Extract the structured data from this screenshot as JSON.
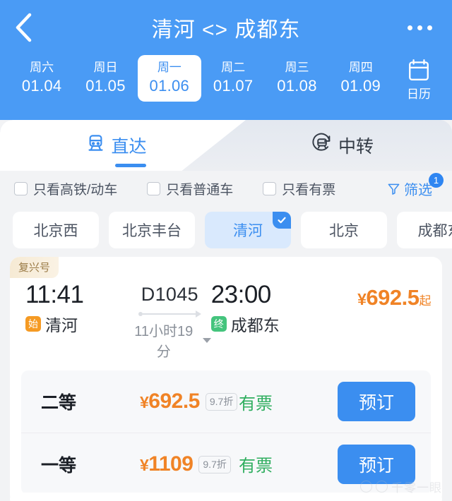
{
  "header": {
    "back_icon": "chevron-left-icon",
    "title": "清河 <> 成都东",
    "more_icon": "more-horizontal-icon",
    "calendar": {
      "icon": "calendar-icon",
      "label": "日历"
    },
    "dates": [
      {
        "weekday": "周六",
        "date": "01.04",
        "active": false
      },
      {
        "weekday": "周日",
        "date": "01.05",
        "active": false
      },
      {
        "weekday": "周一",
        "date": "01.06",
        "active": true
      },
      {
        "weekday": "周二",
        "date": "01.07",
        "active": false
      },
      {
        "weekday": "周三",
        "date": "01.08",
        "active": false
      },
      {
        "weekday": "周四",
        "date": "01.09",
        "active": false
      }
    ]
  },
  "tabs": [
    {
      "label": "直达",
      "icon": "train-front-icon",
      "active": true
    },
    {
      "label": "中转",
      "icon": "train-transfer-icon",
      "active": false
    }
  ],
  "filters": {
    "checkboxes": [
      {
        "label": "只看高铁/动车",
        "checked": false
      },
      {
        "label": "只看普通车",
        "checked": false
      },
      {
        "label": "只看有票",
        "checked": false
      }
    ],
    "filter_button": {
      "label": "筛选",
      "icon": "funnel-icon",
      "badge": "1"
    }
  },
  "stations": [
    {
      "name": "北京西",
      "selected": false
    },
    {
      "name": "北京丰台",
      "selected": false
    },
    {
      "name": "清河",
      "selected": true
    },
    {
      "name": "北京",
      "selected": false
    },
    {
      "name": "成都东",
      "selected": false
    }
  ],
  "train": {
    "brand_tag": "复兴号",
    "depart_time": "11:41",
    "depart_badge": "始",
    "depart_station": "清河",
    "train_no": "D1045",
    "duration": "11小时19分",
    "arrive_time": "23:00",
    "arrive_badge": "终",
    "arrive_station": "成都东",
    "price_yen": "¥",
    "price_from": "692.5",
    "price_suffix": "起",
    "seats": [
      {
        "class": "二等",
        "yen": "¥",
        "price": "692.5",
        "discount": "9.7折",
        "stock": "有票",
        "book": "预订"
      },
      {
        "class": "一等",
        "yen": "¥",
        "price": "1109",
        "discount": "9.7折",
        "stock": "有票",
        "book": "预订"
      }
    ]
  },
  "watermark": {
    "text": "千零一眼"
  },
  "colors": {
    "brand_blue": "#4a9bf5",
    "accent_blue": "#3b8ef0",
    "price_orange": "#f08326",
    "stock_green": "#2fae5f",
    "start_badge": "#f59a23",
    "end_badge": "#44c47d"
  }
}
